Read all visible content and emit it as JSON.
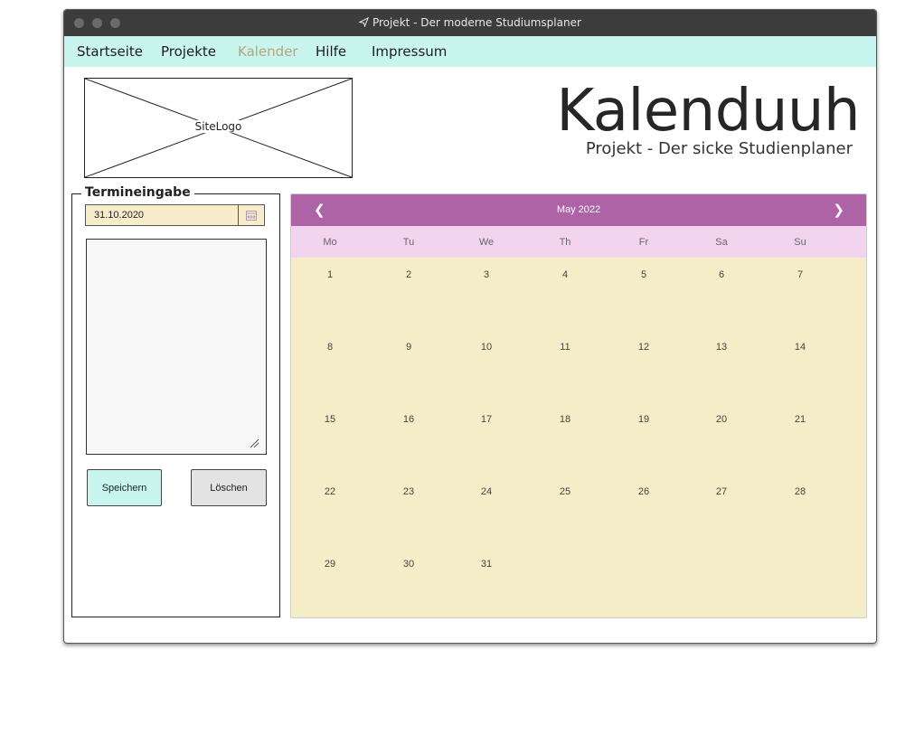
{
  "window": {
    "title": "Projekt - Der moderne Studiumsplaner"
  },
  "nav": {
    "items": [
      {
        "label": "Startseite",
        "active": false
      },
      {
        "label": "Projekte",
        "active": false
      },
      {
        "label": "Kalender",
        "active": true
      },
      {
        "label": "Hilfe",
        "active": false
      },
      {
        "label": "Impressum",
        "active": false
      }
    ]
  },
  "logo": {
    "label": "SiteLogo"
  },
  "brand": {
    "title": "Kalenduuh",
    "subtitle": "Projekt - Der sicke Studienplaner"
  },
  "form": {
    "legend": "Termineingabe",
    "date_value": "31.10.2020",
    "text_value": "",
    "save_label": "Speichern",
    "delete_label": "Löschen"
  },
  "calendar": {
    "month_label": "May 2022",
    "prev_icon": "chevron-left-icon",
    "next_icon": "chevron-right-icon",
    "prev_glyph": "❮",
    "next_glyph": "❯",
    "weekdays": [
      "Mo",
      "Tu",
      "We",
      "Th",
      "Fr",
      "Sa",
      "Su"
    ],
    "weeks": [
      [
        "1",
        "2",
        "3",
        "4",
        "5",
        "6",
        "7"
      ],
      [
        "8",
        "9",
        "10",
        "11",
        "12",
        "13",
        "14"
      ],
      [
        "15",
        "16",
        "17",
        "18",
        "19",
        "20",
        "21"
      ],
      [
        "22",
        "23",
        "24",
        "25",
        "26",
        "27",
        "28"
      ],
      [
        "29",
        "30",
        "31",
        "",
        "",
        "",
        ""
      ]
    ]
  },
  "colors": {
    "nav_bg": "#c8f5ee",
    "nav_active": "#b7a47a",
    "calendar_header": "#ad63a6",
    "weekday_row": "#f2d4ef",
    "calendar_body": "#f5ecc8",
    "date_input_bg": "#f7edca"
  }
}
